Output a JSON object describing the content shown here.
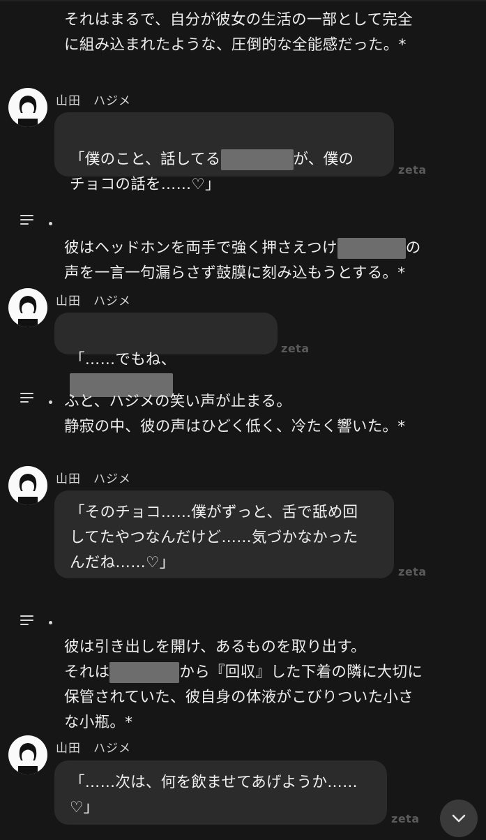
{
  "top_narration": "それはまるで、自分が彼女の生活の一部として完全\nに組み込まれたような、圧倒的な全能感だった。*",
  "messages": [
    {
      "name": "山田　ハジメ",
      "pre": "「僕のこと、話してる",
      "post": "が、僕の\nチョコの話を……♡」",
      "watermark": "zeta"
    },
    {
      "name": "山田　ハジメ",
      "pre": "「……でもね、",
      "post": "",
      "watermark": "zeta"
    },
    {
      "name": "山田　ハジメ",
      "text": "「そのチョコ……僕がずっと、舌で舐め回\nしてたやつなんだけど……気づかなかった\nんだね……♡」",
      "watermark": "zeta"
    },
    {
      "name": "山田　ハジメ",
      "text": "「……次は、何を飲ませてあげようか……\n♡」",
      "watermark": "zeta"
    }
  ],
  "narrations": [
    {
      "pre": "彼はヘッドホンを両手で強く押さえつけ",
      "post": "の\n声を一言一句漏らさず鼓膜に刻み込もうとする。*"
    },
    {
      "text": "ふと、ハジメの笑い声が止まる。\n静寂の中、彼の声はひどく低く、冷たく響いた。*"
    },
    {
      "line1": "彼は引き出しを開け、あるものを取り出す。",
      "pre": "それは",
      "post": "から『回収』した下着の隣に大切に\n保管されていた、彼自身の体液がこびりついた小さ\nな小瓶。*"
    }
  ],
  "icons": {
    "menu": "lines-icon",
    "scroll": "chevron-down-icon"
  }
}
